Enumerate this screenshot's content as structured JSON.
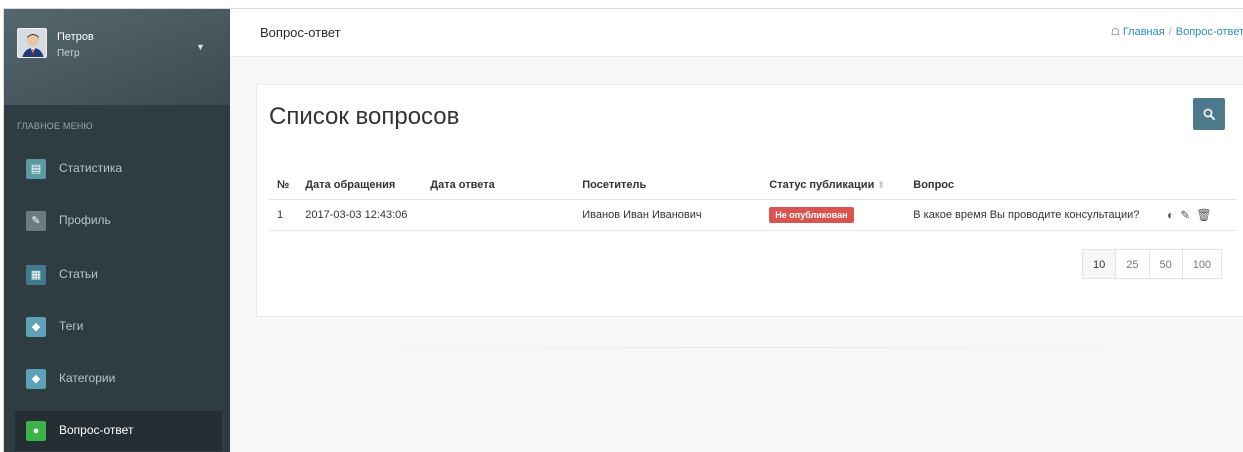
{
  "user": {
    "name": "Петров",
    "sub": "Петр"
  },
  "menu": {
    "title": "ГЛАВНОЕ МЕНЮ",
    "items": [
      {
        "label": "Статистика",
        "icon": "list-icon",
        "color": "#5b9aa5"
      },
      {
        "label": "Профиль",
        "icon": "pencil-icon",
        "color": "#6c7b81"
      },
      {
        "label": "Статьи",
        "icon": "newspaper-icon",
        "color": "#417a8c"
      },
      {
        "label": "Теги",
        "icon": "tag-icon",
        "color": "#5fa2b8"
      },
      {
        "label": "Категории",
        "icon": "tags-icon",
        "color": "#5fa2b8"
      },
      {
        "label": "Вопрос-ответ",
        "icon": "comment-icon",
        "color": "#3cb44a"
      }
    ]
  },
  "header": {
    "title": "Вопрос-ответ"
  },
  "breadcrumb": {
    "home": "Главная",
    "current": "Вопрос-ответ"
  },
  "panel": {
    "title": "Список вопросов"
  },
  "table": {
    "columns": [
      "№",
      "Дата обращения",
      "Дата ответа",
      "Посетитель",
      "Статус публикации",
      "Вопрос"
    ],
    "rows": [
      {
        "num": "1",
        "date_request": "2017-03-03 12:43:06",
        "date_answer": "",
        "visitor": "Иванов Иван Иванович",
        "status": "Не опубликован",
        "question": "В какое время Вы проводите консультации?"
      }
    ]
  },
  "pager": [
    "10",
    "25",
    "50",
    "100"
  ],
  "colors": {
    "status_unpublished": "#d9534f",
    "accent": "#4c7a8c",
    "link": "#2b8bc3"
  }
}
